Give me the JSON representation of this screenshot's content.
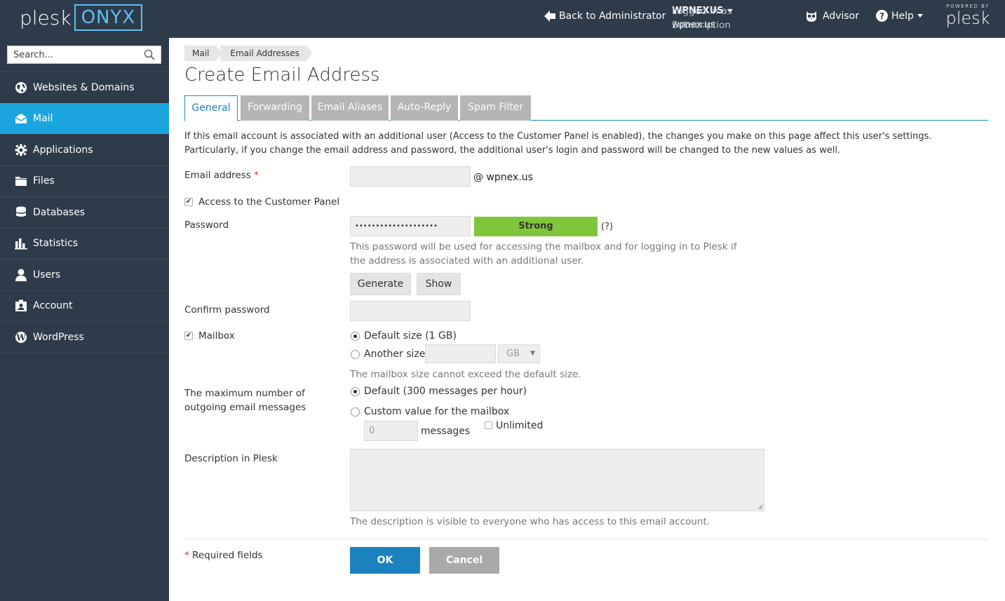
{
  "header": {
    "logo_brand": "plesk",
    "logo_edition": "ONYX",
    "back_label": "Back to Administrator",
    "logged_in_label": "Logged in as",
    "logged_in_user": "WPNEXUS",
    "subscription_label": "Subscription",
    "subscription_value": "wpnex.us",
    "advisor_label": "Advisor",
    "help_label": "Help",
    "powered_by": "POWERED BY",
    "powered_brand": "plesk"
  },
  "sidebar": {
    "search_placeholder": "Search...",
    "items": [
      {
        "label": "Websites & Domains",
        "icon": "globe-icon"
      },
      {
        "label": "Mail",
        "icon": "mail-icon",
        "active": true
      },
      {
        "label": "Applications",
        "icon": "gear-icon"
      },
      {
        "label": "Files",
        "icon": "folder-icon"
      },
      {
        "label": "Databases",
        "icon": "database-icon"
      },
      {
        "label": "Statistics",
        "icon": "bar-chart-icon"
      },
      {
        "label": "Users",
        "icon": "user-icon"
      },
      {
        "label": "Account",
        "icon": "account-icon"
      },
      {
        "label": "WordPress",
        "icon": "wordpress-icon"
      }
    ]
  },
  "breadcrumb": [
    "Mail",
    "Email Addresses"
  ],
  "page_title": "Create Email Address",
  "tabs": [
    "General",
    "Forwarding",
    "Email Aliases",
    "Auto-Reply",
    "Spam Filter"
  ],
  "intro": "If this email account is associated with an additional user (Access to the Customer Panel is enabled), the changes you make on this page affect this user's settings. Particularly, if you change the email address and password, the additional user's login and password will be changed to the new values as well.",
  "form": {
    "email_label": "Email address",
    "required_mark": "*",
    "email_value": "",
    "email_domain": "@ wpnex.us",
    "customer_panel_label": "Access to the Customer Panel",
    "password_label": "Password",
    "password_value": "••••••••••••••••••••",
    "strength_label": "Strong",
    "help_mark": "(?)",
    "password_hint": "This password will be used for accessing the mailbox and for logging in to Plesk if the address is associated with an additional user.",
    "generate_label": "Generate",
    "show_label": "Show",
    "confirm_label": "Confirm password",
    "mailbox_label": "Mailbox",
    "default_size_label": "Default size (1 GB)",
    "another_size_label": "Another size",
    "size_unit": "GB",
    "mailbox_hint": "The mailbox size cannot exceed the default size.",
    "max_outgoing_label_1": "The maximum number of",
    "max_outgoing_label_2": "outgoing email messages",
    "default_messages_label": "Default (300 messages per hour)",
    "custom_value_label": "Custom value for the mailbox",
    "messages_value": "0",
    "messages_unit": "messages",
    "unlimited_label": "Unlimited",
    "description_label": "Description in Plesk",
    "description_hint": "The description is visible to everyone who has access to this email account.",
    "required_fields_label": "Required fields",
    "ok_label": "OK",
    "cancel_label": "Cancel"
  },
  "colors": {
    "header_bg": "#2d3b4a",
    "active_nav": "#1aa5df",
    "primary_button": "#1a82bf",
    "strength_bar": "#80c63b"
  }
}
